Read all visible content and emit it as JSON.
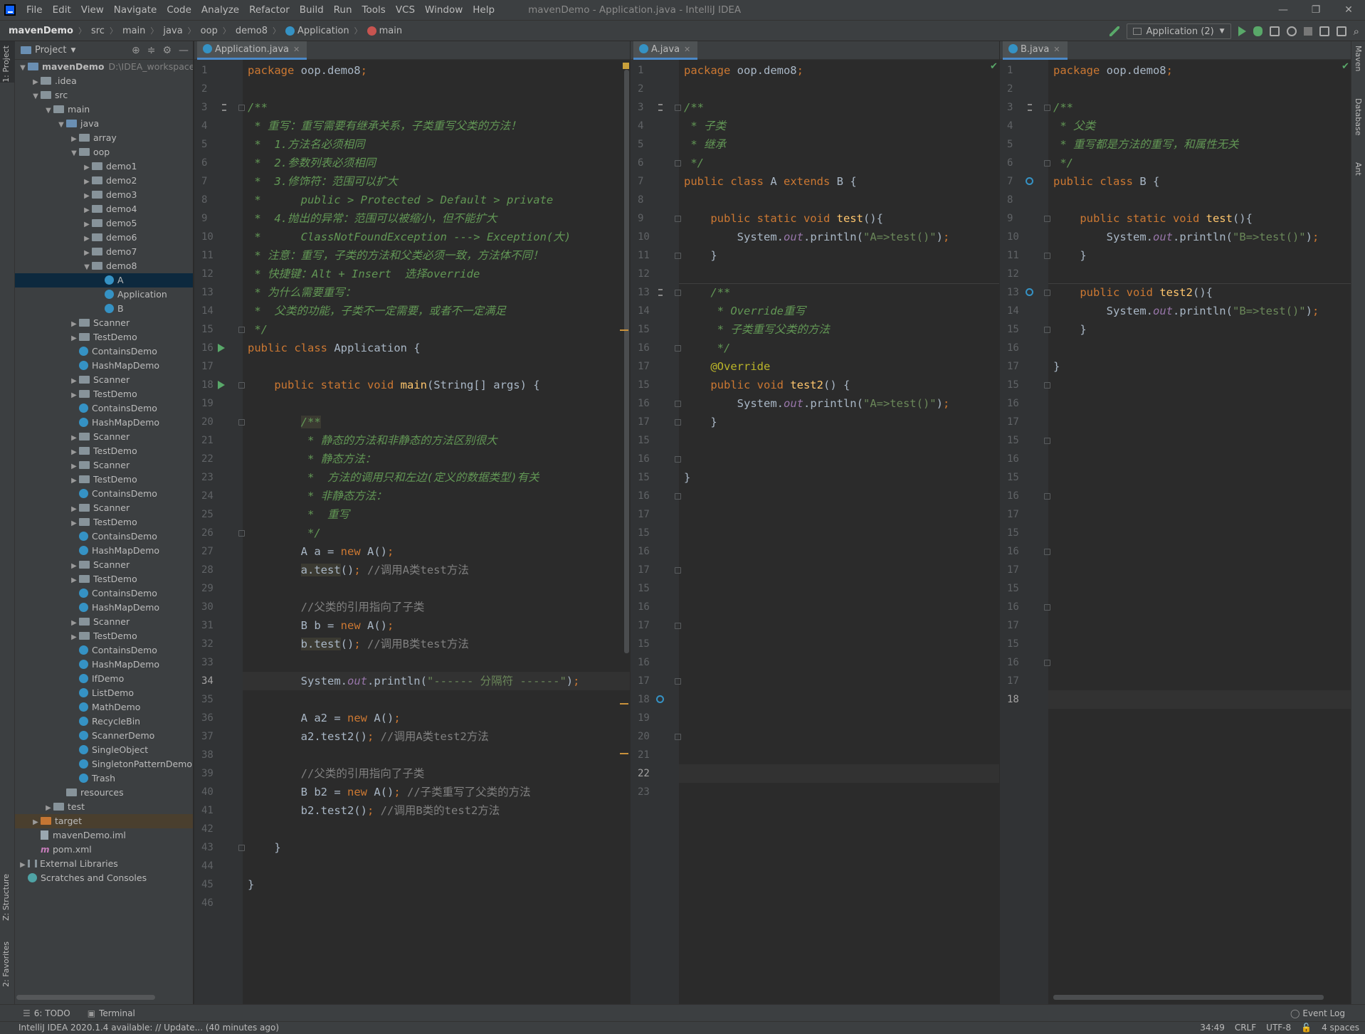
{
  "menubar": {
    "items": [
      "File",
      "Edit",
      "View",
      "Navigate",
      "Code",
      "Analyze",
      "Refactor",
      "Build",
      "Run",
      "Tools",
      "VCS",
      "Window",
      "Help"
    ],
    "title": "mavenDemo - Application.java - IntelliJ IDEA"
  },
  "navbar": {
    "crumbs": [
      "mavenDemo",
      "src",
      "main",
      "java",
      "oop",
      "demo8",
      "Application",
      "main"
    ],
    "run_config": "Application (2)"
  },
  "left_strip": {
    "project": "1: Project",
    "structure": "Z: Structure",
    "favorites": "2: Favorites"
  },
  "right_strip": {
    "maven": "Maven",
    "database": "Database",
    "ant": "Ant"
  },
  "project_panel": {
    "title": "Project",
    "tree": [
      {
        "label": "mavenDemo",
        "extra": "D:\\IDEA_workspace\\m",
        "indent": 0,
        "arrow": "▼",
        "icon": "folder-blue"
      },
      {
        "label": ".idea",
        "indent": 1,
        "arrow": "▶",
        "icon": "folder"
      },
      {
        "label": "src",
        "indent": 1,
        "arrow": "▼",
        "icon": "folder"
      },
      {
        "label": "main",
        "indent": 2,
        "arrow": "▼",
        "icon": "folder"
      },
      {
        "label": "java",
        "indent": 3,
        "arrow": "▼",
        "icon": "folder-blue"
      },
      {
        "label": "array",
        "indent": 4,
        "arrow": "▶",
        "icon": "folder"
      },
      {
        "label": "oop",
        "indent": 4,
        "arrow": "▼",
        "icon": "folder"
      },
      {
        "label": "demo1",
        "indent": 5,
        "arrow": "▶",
        "icon": "folder"
      },
      {
        "label": "demo2",
        "indent": 5,
        "arrow": "▶",
        "icon": "folder"
      },
      {
        "label": "demo3",
        "indent": 5,
        "arrow": "▶",
        "icon": "folder"
      },
      {
        "label": "demo4",
        "indent": 5,
        "arrow": "▶",
        "icon": "folder"
      },
      {
        "label": "demo5",
        "indent": 5,
        "arrow": "▶",
        "icon": "folder"
      },
      {
        "label": "demo6",
        "indent": 5,
        "arrow": "▶",
        "icon": "folder"
      },
      {
        "label": "demo7",
        "indent": 5,
        "arrow": "▶",
        "icon": "folder"
      },
      {
        "label": "demo8",
        "indent": 5,
        "arrow": "▼",
        "icon": "folder"
      },
      {
        "label": "A",
        "indent": 6,
        "arrow": "",
        "icon": "class",
        "selected": true
      },
      {
        "label": "Application",
        "indent": 6,
        "arrow": "",
        "icon": "class"
      },
      {
        "label": "B",
        "indent": 6,
        "arrow": "",
        "icon": "class"
      },
      {
        "label": "Scanner",
        "indent": 4,
        "arrow": "▶",
        "icon": "folder"
      },
      {
        "label": "TestDemo",
        "indent": 4,
        "arrow": "▶",
        "icon": "folder"
      },
      {
        "label": "ContainsDemo",
        "indent": 4,
        "arrow": "",
        "icon": "class"
      },
      {
        "label": "HashMapDemo",
        "indent": 4,
        "arrow": "",
        "icon": "class"
      },
      {
        "label": "Scanner",
        "indent": 4,
        "arrow": "▶",
        "icon": "folder"
      },
      {
        "label": "TestDemo",
        "indent": 4,
        "arrow": "▶",
        "icon": "folder"
      },
      {
        "label": "ContainsDemo",
        "indent": 4,
        "arrow": "",
        "icon": "class"
      },
      {
        "label": "HashMapDemo",
        "indent": 4,
        "arrow": "",
        "icon": "class"
      },
      {
        "label": "Scanner",
        "indent": 4,
        "arrow": "▶",
        "icon": "folder"
      },
      {
        "label": "TestDemo",
        "indent": 4,
        "arrow": "▶",
        "icon": "folder"
      },
      {
        "label": "Scanner",
        "indent": 4,
        "arrow": "▶",
        "icon": "folder"
      },
      {
        "label": "TestDemo",
        "indent": 4,
        "arrow": "▶",
        "icon": "folder"
      },
      {
        "label": "ContainsDemo",
        "indent": 4,
        "arrow": "",
        "icon": "class"
      },
      {
        "label": "Scanner",
        "indent": 4,
        "arrow": "▶",
        "icon": "folder"
      },
      {
        "label": "TestDemo",
        "indent": 4,
        "arrow": "▶",
        "icon": "folder"
      },
      {
        "label": "ContainsDemo",
        "indent": 4,
        "arrow": "",
        "icon": "class"
      },
      {
        "label": "HashMapDemo",
        "indent": 4,
        "arrow": "",
        "icon": "class"
      },
      {
        "label": "Scanner",
        "indent": 4,
        "arrow": "▶",
        "icon": "folder"
      },
      {
        "label": "TestDemo",
        "indent": 4,
        "arrow": "▶",
        "icon": "folder"
      },
      {
        "label": "ContainsDemo",
        "indent": 4,
        "arrow": "",
        "icon": "class"
      },
      {
        "label": "HashMapDemo",
        "indent": 4,
        "arrow": "",
        "icon": "class"
      },
      {
        "label": "Scanner",
        "indent": 4,
        "arrow": "▶",
        "icon": "folder"
      },
      {
        "label": "TestDemo",
        "indent": 4,
        "arrow": "▶",
        "icon": "folder"
      },
      {
        "label": "ContainsDemo",
        "indent": 4,
        "arrow": "",
        "icon": "class"
      },
      {
        "label": "HashMapDemo",
        "indent": 4,
        "arrow": "",
        "icon": "class"
      },
      {
        "label": "IfDemo",
        "indent": 4,
        "arrow": "",
        "icon": "class"
      },
      {
        "label": "ListDemo",
        "indent": 4,
        "arrow": "",
        "icon": "class"
      },
      {
        "label": "MathDemo",
        "indent": 4,
        "arrow": "",
        "icon": "class"
      },
      {
        "label": "RecycleBin",
        "indent": 4,
        "arrow": "",
        "icon": "class"
      },
      {
        "label": "ScannerDemo",
        "indent": 4,
        "arrow": "",
        "icon": "class"
      },
      {
        "label": "SingleObject",
        "indent": 4,
        "arrow": "",
        "icon": "class"
      },
      {
        "label": "SingletonPatternDemo",
        "indent": 4,
        "arrow": "",
        "icon": "class"
      },
      {
        "label": "Trash",
        "indent": 4,
        "arrow": "",
        "icon": "class"
      },
      {
        "label": "resources",
        "indent": 3,
        "arrow": "",
        "icon": "folder"
      },
      {
        "label": "test",
        "indent": 2,
        "arrow": "▶",
        "icon": "folder"
      },
      {
        "label": "target",
        "indent": 1,
        "arrow": "▶",
        "icon": "folder-orange",
        "target": true
      },
      {
        "label": "mavenDemo.iml",
        "indent": 1,
        "arrow": "",
        "icon": "file"
      },
      {
        "label": "pom.xml",
        "indent": 1,
        "arrow": "",
        "icon": "maven"
      },
      {
        "label": "External Libraries",
        "indent": 0,
        "arrow": "▶",
        "icon": "lib"
      },
      {
        "label": "Scratches and Consoles",
        "indent": 0,
        "arrow": "",
        "icon": "scratch"
      }
    ]
  },
  "editors": [
    {
      "tab": "Application.java",
      "current_line": "34",
      "lines": [
        {
          "n": "1",
          "h": "<span class=\"kw\">package </span>oop.demo8<span class=\"kw\">;</span>"
        },
        {
          "n": "2",
          "h": ""
        },
        {
          "n": "3",
          "h": "<span class=\"doc\">/**</span>"
        },
        {
          "n": "4",
          "h": "<span class=\"doc\"> * 重写：重写需要有继承关系，子类重写父类的方法！</span>"
        },
        {
          "n": "5",
          "h": "<span class=\"doc\"> *  1.方法名必须相同</span>"
        },
        {
          "n": "6",
          "h": "<span class=\"doc\"> *  2.参数列表必须相同</span>"
        },
        {
          "n": "7",
          "h": "<span class=\"doc\"> *  3.修饰符：范围可以扩大</span>"
        },
        {
          "n": "8",
          "h": "<span class=\"doc\"> *      public &gt; Protected &gt; Default &gt; private</span>"
        },
        {
          "n": "9",
          "h": "<span class=\"doc\"> *  4.抛出的异常：范围可以被缩小，但不能扩大</span>"
        },
        {
          "n": "10",
          "h": "<span class=\"doc\"> *      ClassNotFoundException ---&gt; Exception(大)</span>"
        },
        {
          "n": "11",
          "h": "<span class=\"doc\"> * 注意：重写，子类的方法和父类必须一致，方法体不同！</span>"
        },
        {
          "n": "12",
          "h": "<span class=\"doc\"> * 快捷键：Alt + Insert  选择override</span>"
        },
        {
          "n": "13",
          "h": "<span class=\"doc\"> * 为什么需要重写：</span>"
        },
        {
          "n": "14",
          "h": "<span class=\"doc\"> *  父类的功能，子类不一定需要，或者不一定满足</span>"
        },
        {
          "n": "15",
          "h": "<span class=\"doc\"> */</span>"
        },
        {
          "n": "16",
          "h": "<span class=\"kw\">public class </span>Application {"
        },
        {
          "n": "17",
          "h": ""
        },
        {
          "n": "18",
          "h": "    <span class=\"kw\">public static void </span><span class=\"fn\">main</span>(String[] args) {"
        },
        {
          "n": "19",
          "h": ""
        },
        {
          "n": "20",
          "h": "        <span class=\"doc hl\">/**</span>"
        },
        {
          "n": "21",
          "h": "<span class=\"doc\">         * 静态的方法和非静态的方法区别很大</span>"
        },
        {
          "n": "22",
          "h": "<span class=\"doc\">         * 静态方法：</span>"
        },
        {
          "n": "23",
          "h": "<span class=\"doc\">         *  方法的调用只和左边(定义的数据类型)有关</span>"
        },
        {
          "n": "24",
          "h": "<span class=\"doc\">         * 非静态方法：</span>"
        },
        {
          "n": "25",
          "h": "<span class=\"doc\">         *  重写</span>"
        },
        {
          "n": "26",
          "h": "<span class=\"doc\">         */</span>"
        },
        {
          "n": "27",
          "h": "        A a = <span class=\"kw\">new </span>A()<span class=\"kw\">;</span>"
        },
        {
          "n": "28",
          "h": "        <span class=\"hl\">a.test</span>()<span class=\"kw\">; </span><span class=\"cmt\">//调用A类test方法</span>"
        },
        {
          "n": "29",
          "h": ""
        },
        {
          "n": "30",
          "h": "        <span class=\"cmt\">//父类的引用指向了子类</span>"
        },
        {
          "n": "31",
          "h": "        B b = <span class=\"kw\">new </span>A()<span class=\"kw\">;</span>"
        },
        {
          "n": "32",
          "h": "        <span class=\"hl\">b.test</span>()<span class=\"kw\">; </span><span class=\"cmt\">//调用B类test方法</span>"
        },
        {
          "n": "33",
          "h": ""
        },
        {
          "n": "34",
          "h": "        System.<span class=\"st\">out</span>.println(<span class=\"str\">\"------ 分隔符 ------\"</span>)<span class=\"kw\">;</span>"
        },
        {
          "n": "35",
          "h": ""
        },
        {
          "n": "36",
          "h": "        A a2 = <span class=\"kw\">new </span>A()<span class=\"kw\">;</span>"
        },
        {
          "n": "37",
          "h": "        a2.test2()<span class=\"kw\">; </span><span class=\"cmt\">//调用A类test2方法</span>"
        },
        {
          "n": "38",
          "h": ""
        },
        {
          "n": "39",
          "h": "        <span class=\"cmt\">//父类的引用指向了子类</span>"
        },
        {
          "n": "40",
          "h": "        B b2 = <span class=\"kw\">new </span>A()<span class=\"kw\">; </span><span class=\"cmt\">//子类重写了父类的方法</span>"
        },
        {
          "n": "41",
          "h": "        b2.test2()<span class=\"kw\">; </span><span class=\"cmt\">//调用B类的test2方法</span>"
        },
        {
          "n": "42",
          "h": ""
        },
        {
          "n": "43",
          "h": "    }"
        },
        {
          "n": "44",
          "h": ""
        },
        {
          "n": "45",
          "h": "}"
        },
        {
          "n": "46",
          "h": ""
        }
      ]
    },
    {
      "tab": "A.java",
      "current_line": "22",
      "lines": [
        {
          "n": "1",
          "h": "<span class=\"kw\">package </span>oop.demo8<span class=\"kw\">;</span>"
        },
        {
          "n": "2",
          "h": ""
        },
        {
          "n": "3",
          "h": "<span class=\"doc\">/**</span>"
        },
        {
          "n": "4",
          "h": "<span class=\"doc\"> * 子类</span>"
        },
        {
          "n": "5",
          "h": "<span class=\"doc\"> * 继承</span>"
        },
        {
          "n": "6",
          "h": "<span class=\"doc\"> */</span>"
        },
        {
          "n": "7",
          "h": "<span class=\"kw\">public class </span>A <span class=\"kw\">extends </span>B {"
        },
        {
          "n": "8",
          "h": ""
        },
        {
          "n": "9",
          "h": "    <span class=\"kw\">public static void </span><span class=\"fn\">test</span>(){"
        },
        {
          "n": "10",
          "h": "        System.<span class=\"st\">out</span>.println(<span class=\"str\">\"A=&gt;test()\"</span>)<span class=\"kw\">;</span>"
        },
        {
          "n": "11",
          "h": "    }"
        },
        {
          "n": "12",
          "h": ""
        },
        {
          "n": "13",
          "h": "    <span class=\"doc\">/**</span>"
        },
        {
          "n": "14",
          "h": "<span class=\"doc\">     * Override重写</span>"
        },
        {
          "n": "15",
          "h": "<span class=\"doc\">     * 子类重写父类的方法</span>"
        },
        {
          "n": "16",
          "h": "<span class=\"doc\">     */</span>"
        },
        {
          "n": "17",
          "h": "    <span class=\"ann\">@Override</span>"
        },
        {
          "n": "15",
          "h": "    <span class=\"kw\">public void </span><span class=\"fn\">test2</span>() {"
        },
        {
          "n": "16",
          "h": "        System.<span class=\"st\">out</span>.println(<span class=\"str\">\"A=&gt;test()\"</span>)<span class=\"kw\">;</span>"
        },
        {
          "n": "17",
          "h": "    }"
        },
        {
          "n": "15",
          "h": ""
        },
        {
          "n": "16",
          "h": ""
        },
        {
          "n": "15",
          "h": "}"
        },
        {
          "n": "16",
          "h": ""
        },
        {
          "n": "17",
          "h": ""
        },
        {
          "n": "15",
          "h": ""
        },
        {
          "n": "16",
          "h": ""
        },
        {
          "n": "17",
          "h": ""
        },
        {
          "n": "15",
          "h": ""
        },
        {
          "n": "16",
          "h": ""
        },
        {
          "n": "17",
          "h": ""
        },
        {
          "n": "15",
          "h": ""
        },
        {
          "n": "16",
          "h": ""
        },
        {
          "n": "17",
          "h": ""
        },
        {
          "n": "18",
          "h": ""
        },
        {
          "n": "19",
          "h": ""
        },
        {
          "n": "20",
          "h": ""
        },
        {
          "n": "21",
          "h": ""
        },
        {
          "n": "22",
          "h": ""
        },
        {
          "n": "23",
          "h": ""
        }
      ]
    },
    {
      "tab": "B.java",
      "current_line": "18",
      "lines": [
        {
          "n": "1",
          "h": "<span class=\"kw\">package </span>oop.demo8<span class=\"kw\">;</span>"
        },
        {
          "n": "2",
          "h": ""
        },
        {
          "n": "3",
          "h": "<span class=\"doc\">/**</span>"
        },
        {
          "n": "4",
          "h": "<span class=\"doc\"> * 父类</span>"
        },
        {
          "n": "5",
          "h": "<span class=\"doc\"> * 重写都是方法的重写，和属性无关</span>"
        },
        {
          "n": "6",
          "h": "<span class=\"doc\"> */</span>"
        },
        {
          "n": "7",
          "h": "<span class=\"kw\">public class </span>B {"
        },
        {
          "n": "8",
          "h": ""
        },
        {
          "n": "9",
          "h": "    <span class=\"kw\">public static void </span><span class=\"fn\">test</span>(){"
        },
        {
          "n": "10",
          "h": "        System.<span class=\"st\">out</span>.println(<span class=\"str\">\"B=&gt;test()\"</span>)<span class=\"kw\">;</span>"
        },
        {
          "n": "11",
          "h": "    }"
        },
        {
          "n": "12",
          "h": ""
        },
        {
          "n": "13",
          "h": "    <span class=\"kw\">public void </span><span class=\"fn\">test2</span>(){"
        },
        {
          "n": "14",
          "h": "        System.<span class=\"st\">out</span>.println(<span class=\"str\">\"B=&gt;test()\"</span>)<span class=\"kw\">;</span>"
        },
        {
          "n": "15",
          "h": "    }"
        },
        {
          "n": "16",
          "h": ""
        },
        {
          "n": "17",
          "h": "}"
        },
        {
          "n": "15",
          "h": ""
        },
        {
          "n": "16",
          "h": ""
        },
        {
          "n": "17",
          "h": ""
        },
        {
          "n": "15",
          "h": ""
        },
        {
          "n": "16",
          "h": ""
        },
        {
          "n": "15",
          "h": ""
        },
        {
          "n": "16",
          "h": ""
        },
        {
          "n": "17",
          "h": ""
        },
        {
          "n": "15",
          "h": ""
        },
        {
          "n": "16",
          "h": ""
        },
        {
          "n": "17",
          "h": ""
        },
        {
          "n": "15",
          "h": ""
        },
        {
          "n": "16",
          "h": ""
        },
        {
          "n": "17",
          "h": ""
        },
        {
          "n": "15",
          "h": ""
        },
        {
          "n": "16",
          "h": ""
        },
        {
          "n": "17",
          "h": ""
        },
        {
          "n": "18",
          "h": ""
        }
      ]
    }
  ],
  "bottom_tools": {
    "todo": "6: TODO",
    "terminal": "Terminal",
    "event_log": "Event Log"
  },
  "status": {
    "message": "IntelliJ IDEA 2020.1.4 available: // Update... (40 minutes ago)",
    "position": "34:49",
    "line_sep": "CRLF",
    "encoding": "UTF-8",
    "indent": "4 spaces"
  }
}
